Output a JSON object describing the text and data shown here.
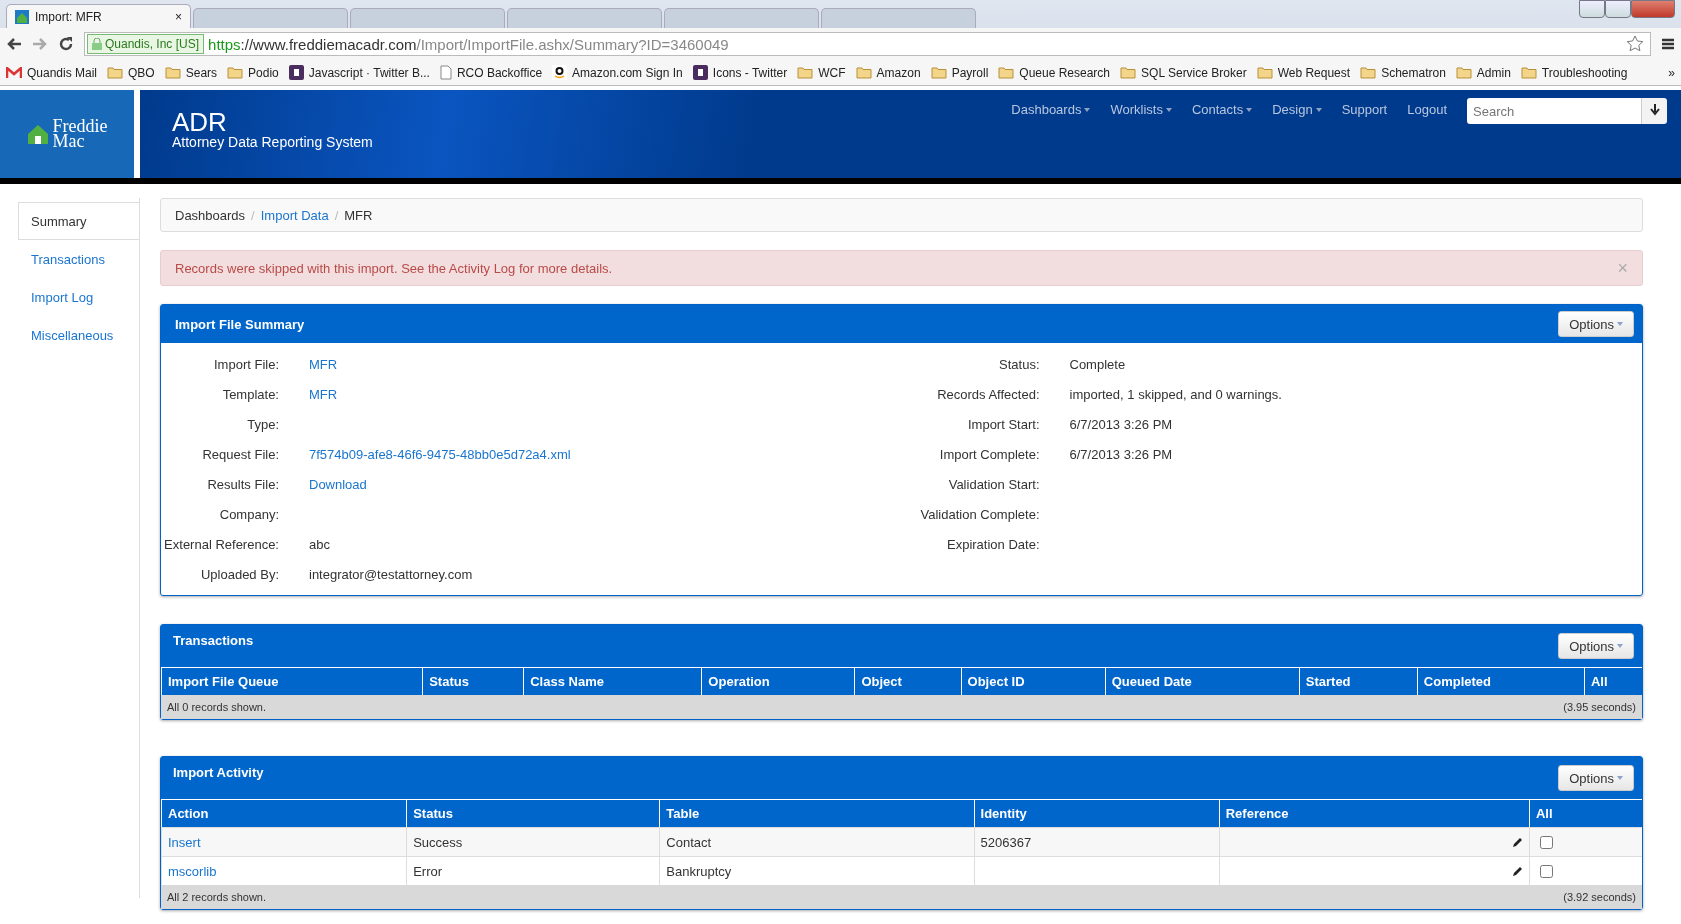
{
  "browser": {
    "tab": {
      "title": "Import: MFR",
      "close": "×"
    },
    "security": "Quandis, Inc [US]",
    "url": {
      "scheme": "https",
      "host": "://www.freddiemacadr.com",
      "path": "/Import/ImportFile.ashx/Summary?ID=3460049"
    },
    "bookmarks": [
      {
        "kind": "mail",
        "label": "Quandis Mail"
      },
      {
        "kind": "folder",
        "label": "QBO"
      },
      {
        "kind": "folder",
        "label": "Sears"
      },
      {
        "kind": "folder",
        "label": "Podio"
      },
      {
        "kind": "b",
        "label": "Javascript · Twitter B..."
      },
      {
        "kind": "page",
        "label": "RCO Backoffice"
      },
      {
        "kind": "amazon",
        "label": "Amazon.com Sign In"
      },
      {
        "kind": "b",
        "label": "Icons - Twitter"
      },
      {
        "kind": "folder",
        "label": "WCF"
      },
      {
        "kind": "folder",
        "label": "Amazon"
      },
      {
        "kind": "folder",
        "label": "Payroll"
      },
      {
        "kind": "folder",
        "label": "Queue Research"
      },
      {
        "kind": "folder",
        "label": "SQL Service Broker"
      },
      {
        "kind": "folder",
        "label": "Web Request"
      },
      {
        "kind": "folder",
        "label": "Schematron"
      },
      {
        "kind": "folder",
        "label": "Admin"
      },
      {
        "kind": "folder",
        "label": "Troubleshooting"
      }
    ],
    "more": "»"
  },
  "header": {
    "logo": [
      "Freddie",
      "Mac"
    ],
    "title": "ADR",
    "subtitle": "Attorney Data Reporting System",
    "nav": [
      {
        "label": "Dashboards",
        "dropdown": true
      },
      {
        "label": "Worklists",
        "dropdown": true
      },
      {
        "label": "Contacts",
        "dropdown": true
      },
      {
        "label": "Design",
        "dropdown": true
      },
      {
        "label": "Support",
        "dropdown": false
      },
      {
        "label": "Logout",
        "dropdown": false
      }
    ],
    "search": {
      "placeholder": "Search"
    }
  },
  "sidebar": [
    {
      "label": "Summary",
      "selected": true
    },
    {
      "label": "Transactions",
      "selected": false
    },
    {
      "label": "Import Log",
      "selected": false
    },
    {
      "label": "Miscellaneous",
      "selected": false
    }
  ],
  "breadcrumb_separator": "/",
  "breadcrumb": [
    {
      "label": "Dashboards",
      "link": false
    },
    {
      "label": "Import Data",
      "link": true
    },
    {
      "label": "MFR",
      "link": false
    }
  ],
  "alert": {
    "text": "Records were skipped with this import. See the Activity Log for more details.",
    "close": "×"
  },
  "summary": {
    "title": "Import File Summary",
    "options": "Options",
    "left": [
      {
        "label": "Import File:",
        "value": "MFR",
        "link": true
      },
      {
        "label": "Template:",
        "value": "MFR",
        "link": true
      },
      {
        "label": "Type:"
      },
      {
        "label": "Request File:",
        "value": "7f574b09-afe8-46f6-9475-48bb0e5d72a4.xml",
        "link": true
      },
      {
        "label": "Results File:",
        "value": "Download",
        "link": true
      },
      {
        "label": "Company:"
      },
      {
        "label": "External Reference:",
        "value": "abc",
        "link": false
      },
      {
        "label": "Uploaded By:",
        "value": "integrator@testattorney.com",
        "link": false
      }
    ],
    "right": [
      {
        "label": "Status:",
        "value": "Complete",
        "link": false
      },
      {
        "label": "Records Affected:",
        "value": "imported, 1 skipped, and 0 warnings.",
        "link": false
      },
      {
        "label": "Import Start:",
        "value": "6/7/2013 3:26 PM",
        "link": false
      },
      {
        "label": "Import Complete:",
        "value": "6/7/2013 3:26 PM",
        "link": false
      },
      {
        "label": "Validation Start:"
      },
      {
        "label": "Validation Complete:"
      },
      {
        "label": "Expiration Date:"
      }
    ]
  },
  "transactions": {
    "title": "Transactions",
    "options": "Options",
    "columns": [
      "Import File Queue",
      "Status",
      "Class Name",
      "Operation",
      "Object",
      "Object ID",
      "Queued Date",
      "Started",
      "Completed",
      "All"
    ],
    "footer": "All 0 records shown.",
    "timing": "(3.95 seconds)"
  },
  "activity": {
    "title": "Import Activity",
    "options": "Options",
    "columns": [
      "Action",
      "Status",
      "Table",
      "Identity",
      "Reference",
      "All"
    ],
    "rows": [
      {
        "action": "Insert",
        "status": "Success",
        "table": "Contact",
        "identity": "5206367",
        "checked": false
      },
      {
        "action": "mscorlib",
        "status": "Error",
        "table": "Bankruptcy",
        "checked": false
      }
    ],
    "footer": "All 2 records shown.",
    "timing": "(3.92 seconds)"
  }
}
